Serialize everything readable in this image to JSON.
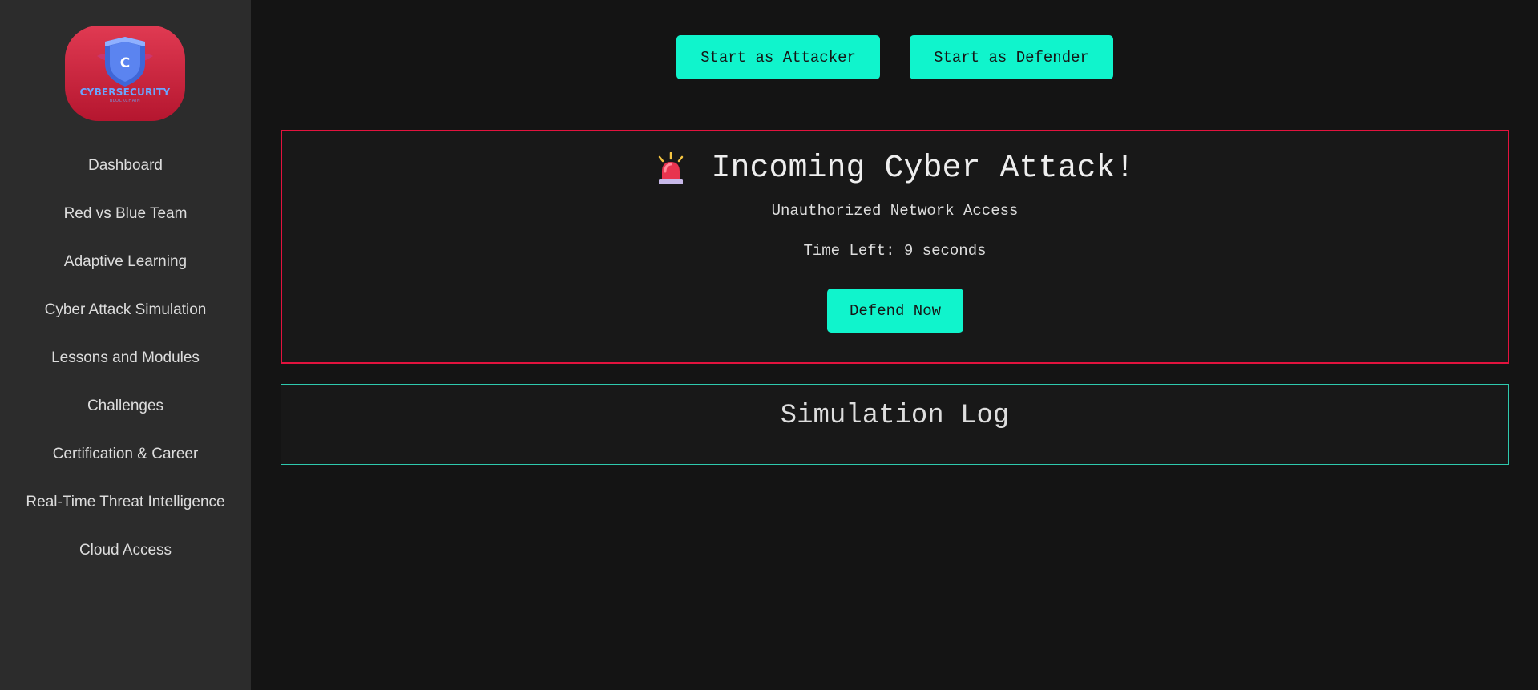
{
  "sidebar": {
    "logo": {
      "letter": "C",
      "text": "CYBERSECURITY",
      "subtext": "BLOCKCHAIN"
    },
    "items": [
      {
        "label": "Dashboard"
      },
      {
        "label": "Red vs Blue Team"
      },
      {
        "label": "Adaptive Learning"
      },
      {
        "label": "Cyber Attack Simulation"
      },
      {
        "label": "Lessons and Modules"
      },
      {
        "label": "Challenges"
      },
      {
        "label": "Certification & Career"
      },
      {
        "label": "Real-Time Threat Intelligence"
      },
      {
        "label": "Cloud Access"
      }
    ]
  },
  "toolbar": {
    "attacker_label": "Start as Attacker",
    "defender_label": "Start as Defender"
  },
  "alert": {
    "icon": "siren-icon",
    "title": "Incoming Cyber Attack!",
    "subtitle": "Unauthorized Network Access",
    "timer": "Time Left: 9 seconds",
    "defend_label": "Defend Now"
  },
  "log": {
    "title": "Simulation Log"
  },
  "colors": {
    "accent": "#10f4cc",
    "alert_border": "#e2133e",
    "log_border": "#2ec9ae",
    "sidebar_bg": "#2c2c2c",
    "page_bg": "#141414"
  }
}
